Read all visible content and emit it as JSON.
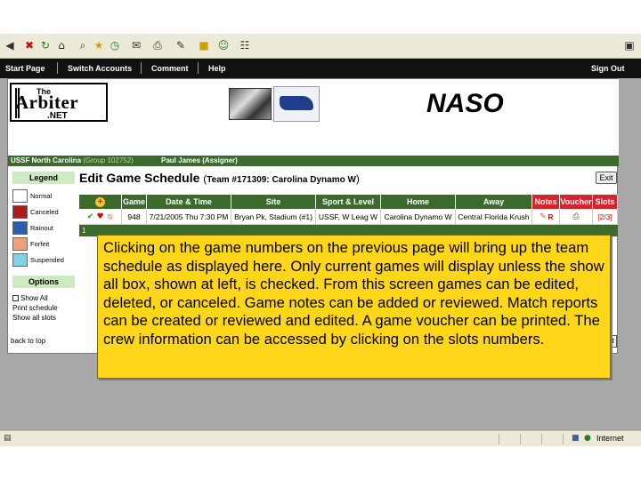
{
  "toolbar_icons": [
    "back-icon",
    "close-icon",
    "refresh-icon",
    "home-icon",
    "search-icon",
    "favorites-icon",
    "history-icon",
    "mail-icon",
    "print-icon",
    "edit-icon",
    "folder-icon",
    "messenger-icon",
    "research-icon"
  ],
  "nav": {
    "start_page": "Start Page",
    "switch_accounts": "Switch Accounts",
    "comment": "Comment",
    "help": "Help",
    "sign_out": "Sign Out"
  },
  "banner": {
    "logo_the": "The",
    "logo_main": "Arbiter",
    "logo_net": ".NET",
    "partner_logo": "NASO"
  },
  "account_strip": {
    "org": "USSF North Carolina",
    "group": "(Group 102752)",
    "user": "Paul James (Assigner)"
  },
  "legend": {
    "title": "Legend",
    "items": [
      {
        "label": "Normal",
        "color": "#ffffff"
      },
      {
        "label": "Canceled",
        "color": "#b01a1a"
      },
      {
        "label": "Rainout",
        "color": "#2a5fb0"
      },
      {
        "label": "Forfeit",
        "color": "#f2a07a"
      },
      {
        "label": "Suspended",
        "color": "#7fd0e8"
      }
    ]
  },
  "options": {
    "title": "Options",
    "show_all": "Show All",
    "print_schedule": "Print schedule",
    "show_all_slots": "Show all slots"
  },
  "page": {
    "title": "Edit Game Schedule",
    "team_prefix": "(",
    "team_id": "Team #171309: Carolina Dynamo W",
    "team_suffix": ")",
    "exit": "Exit"
  },
  "grid": {
    "headers": {
      "add": "+",
      "game": "Game",
      "datetime": "Date & Time",
      "site": "Site",
      "sport": "Sport & Level",
      "home": "Home",
      "away": "Away",
      "notes": "Notes",
      "voucher": "Voucher",
      "slots": "Slots"
    },
    "rows": [
      {
        "game": "948",
        "datetime": "7/21/2005 Thu 7:30 PM",
        "site": "Bryan Pk, Stadium (#1)",
        "sport": "USSF, W Leag W",
        "home": "Carolina Dynamo W",
        "away": "Central Florida Krush",
        "notes_mark": "R",
        "slots": "[2/3]"
      }
    ],
    "footer": "1"
  },
  "back_to_top": "back to top",
  "partial_button": "t",
  "callout": "Clicking on the game numbers on the previous page will bring up the team schedule as displayed here.  Only current games will display unless the show all box, shown at left, is checked.  From this screen games can be edited, deleted, or canceled.  Game notes can be added or reviewed.  Match reports can be created or reviewed and edited.  A game voucher can be printed.  The crew information can be accessed by clicking on the slots numbers.",
  "status": {
    "zone": "Internet"
  }
}
